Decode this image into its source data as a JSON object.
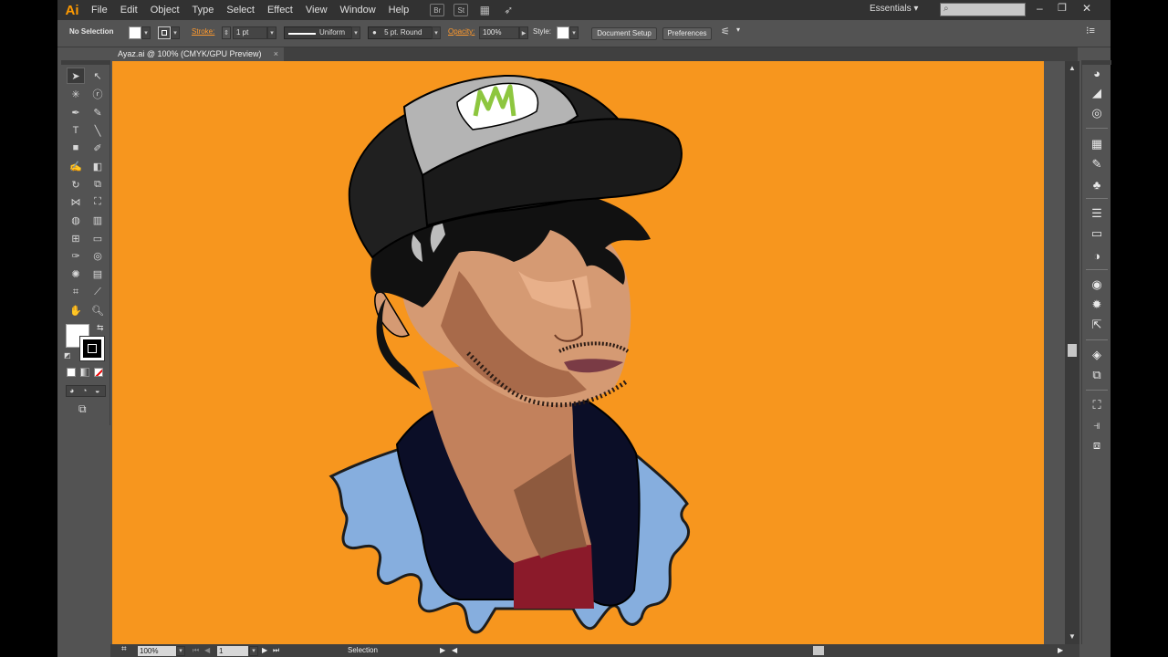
{
  "app": {
    "logo": "Ai",
    "menus": [
      "File",
      "Edit",
      "Object",
      "Type",
      "Select",
      "Effect",
      "View",
      "Window",
      "Help"
    ],
    "bridge_label": "Br",
    "stock_label": "St",
    "workspace": "Essentials",
    "search_placeholder": "",
    "window_controls": [
      "–",
      "❐",
      "✕"
    ]
  },
  "control_bar": {
    "selection_status": "No Selection",
    "stroke_label": "Stroke:",
    "stroke_weight": "1 pt",
    "stroke_profile": "Uniform",
    "brush": "5 pt. Round",
    "opacity_label": "Opacity:",
    "opacity_value": "100%",
    "style_label": "Style:",
    "document_setup": "Document Setup",
    "preferences": "Preferences"
  },
  "document": {
    "tab_title": "Ayaz.ai @ 100% (CMYK/GPU Preview)",
    "close_glyph": "×"
  },
  "status_bar": {
    "zoom": "100%",
    "artboard_number": "1",
    "current_tool": "Selection"
  },
  "colors": {
    "artboard": "#f7961e",
    "brand": "#ff9a00",
    "panel": "#535353",
    "menubar": "#323232"
  }
}
